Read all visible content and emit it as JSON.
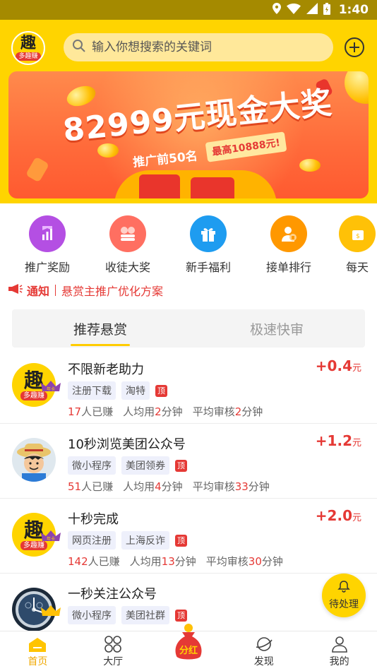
{
  "status_bar": {
    "time": "1:40"
  },
  "header": {
    "logo_text": "趣",
    "logo_sub": "多趣赚",
    "search_placeholder": "输入你想搜索的关键词"
  },
  "banner": {
    "title": "82999元现金大奖",
    "subtitle": "推广前50名",
    "tag": "最高10888元!"
  },
  "quick_menu": [
    {
      "label": "推广奖励",
      "icon": "chart-icon",
      "color": "#b44fe3"
    },
    {
      "label": "收徒大奖",
      "icon": "coins-icon",
      "color": "#ff6f61"
    },
    {
      "label": "新手福利",
      "icon": "gift-icon",
      "color": "#1e9cf0"
    },
    {
      "label": "接单排行",
      "icon": "user-rank-icon",
      "color": "#ff9800"
    },
    {
      "label": "每天",
      "icon": "daily-icon",
      "color": "#ffc107"
    }
  ],
  "notice": {
    "tag": "通知",
    "text": "悬赏主推广优化方案"
  },
  "tabs": {
    "recommended": "推荐悬赏",
    "fast": "极速快审"
  },
  "tasks": [
    {
      "title": "不限新老助力",
      "price": "+0.4",
      "unit": "元",
      "chips": [
        "注册下载",
        "淘特"
      ],
      "top": "顶",
      "earned": "17",
      "earned_suffix": "人已赚",
      "avg_prefix": "人均用",
      "avg": "2",
      "avg_unit": "分钟",
      "review_prefix": "平均审核",
      "review": "2",
      "review_unit": "分钟"
    },
    {
      "title": "10秒浏览美团公众号",
      "price": "+1.2",
      "unit": "元",
      "chips": [
        "微小程序",
        "美团领券"
      ],
      "top": "顶",
      "earned": "51",
      "earned_suffix": "人已赚",
      "avg_prefix": "人均用",
      "avg": "4",
      "avg_unit": "分钟",
      "review_prefix": "平均审核",
      "review": "33",
      "review_unit": "分钟"
    },
    {
      "title": "十秒完成",
      "price": "+2.0",
      "unit": "元",
      "chips": [
        "网页注册",
        "上海反诈"
      ],
      "top": "顶",
      "earned": "142",
      "earned_suffix": "人已赚",
      "avg_prefix": "人均用",
      "avg": "13",
      "avg_unit": "分钟",
      "review_prefix": "平均审核",
      "review": "30",
      "review_unit": "分钟"
    },
    {
      "title": "一秒关注公众号",
      "chips": [
        "微小程序",
        "美团社群"
      ],
      "top": "顶"
    }
  ],
  "avatar_badge": "年卡",
  "pending_button": "待处理",
  "center_button": "分红",
  "bottom_nav": {
    "home": "首页",
    "hall": "大厅",
    "discover": "发现",
    "mine": "我的"
  },
  "colors": {
    "brand_yellow": "#ffd400",
    "price_red": "#e53935",
    "active_nav": "#f0a800"
  }
}
